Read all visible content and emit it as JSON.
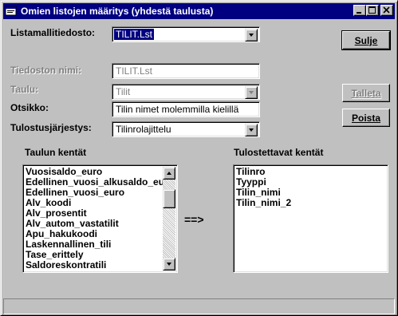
{
  "window": {
    "title": "Omien listojen määritys (yhdestä taulusta)"
  },
  "form": {
    "listamalli_label": "Listamallitiedosto:",
    "listamalli_value": "TILIT.Lst",
    "tiedoston_nimi_label": "Tiedoston nimi:",
    "tiedoston_nimi_value": "TILIT.Lst",
    "taulu_label": "Taulu:",
    "taulu_value": "Tilit",
    "otsikko_label": "Otsikko:",
    "otsikko_value": "Tilin nimet molemmilla kielillä",
    "jarjestys_label": "Tulostusjärjestys:",
    "jarjestys_value": "Tilinrolajittelu"
  },
  "buttons": {
    "sulje": "Sulje",
    "talleta": "Talleta",
    "poista": "Poista"
  },
  "taulun_kentat": {
    "label": "Taulun kentät",
    "items": [
      "Vuosisaldo_euro",
      "Edellinen_vuosi_alkusaldo_eu",
      "Edellinen_vuosi_euro",
      "Alv_koodi",
      "Alv_prosentit",
      "Alv_autom_vastatilit",
      "Apu_hakukoodi",
      "Laskennallinen_tili",
      "Tase_erittely",
      "Saldoreskontratili"
    ]
  },
  "transfer_arrow": "==>",
  "tulostettavat_kentat": {
    "label": "Tulostettavat kentät",
    "items": [
      "Tilinro",
      "Tyyppi",
      "Tilin_nimi",
      "Tilin_nimi_2"
    ]
  },
  "colors": {
    "titlebar": "#000080",
    "face": "#c0c0c0"
  }
}
